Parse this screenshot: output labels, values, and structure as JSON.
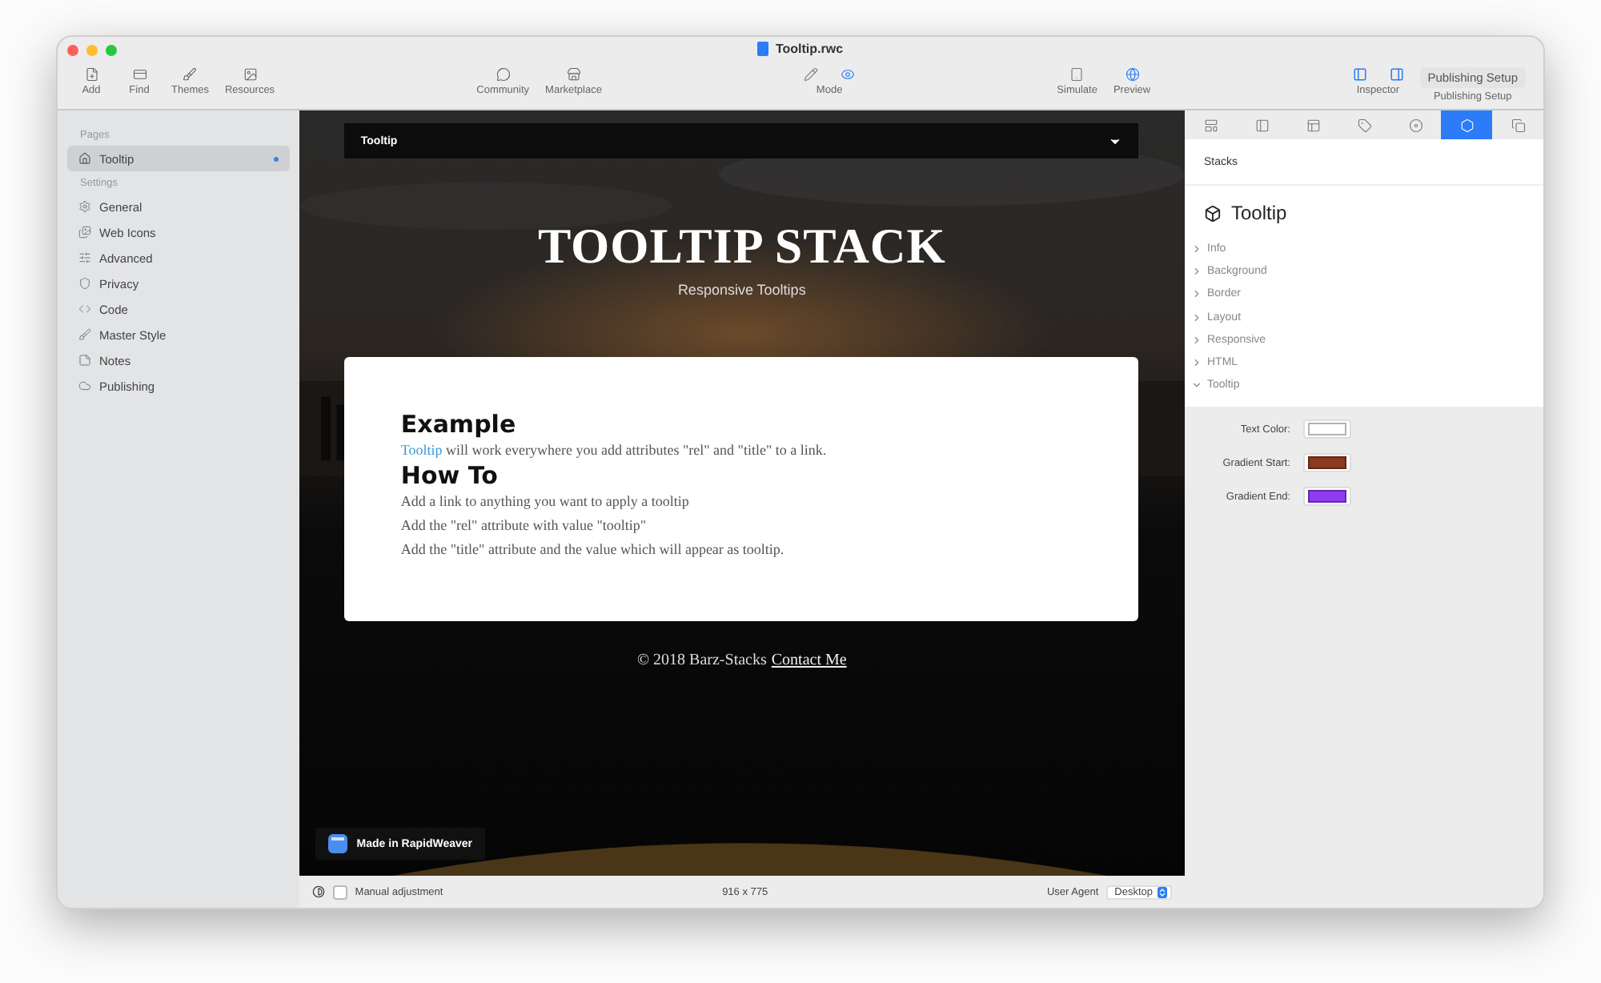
{
  "window": {
    "title": "Tooltip.rwc"
  },
  "toolbar": {
    "left": [
      {
        "label": "Add"
      },
      {
        "label": "Find"
      },
      {
        "label": "Themes"
      },
      {
        "label": "Resources"
      }
    ],
    "center": [
      {
        "label": "Community"
      },
      {
        "label": "Marketplace"
      }
    ],
    "mode": {
      "label": "Mode",
      "options": [
        {
          "selected": false
        },
        {
          "selected": true
        }
      ]
    },
    "right": [
      {
        "label": "Simulate"
      },
      {
        "label": "Preview"
      }
    ],
    "inspector": {
      "label": "Inspector"
    },
    "publishing": {
      "button": "Publishing Setup",
      "label": "Publishing Setup"
    }
  },
  "sidebar": {
    "pages_heading": "Pages",
    "pages": [
      {
        "label": "Tooltip",
        "selected": true,
        "modified": true
      }
    ],
    "settings_heading": "Settings",
    "settings": [
      {
        "label": "General"
      },
      {
        "label": "Web Icons"
      },
      {
        "label": "Advanced"
      },
      {
        "label": "Privacy"
      },
      {
        "label": "Code"
      },
      {
        "label": "Master Style"
      },
      {
        "label": "Notes"
      },
      {
        "label": "Publishing"
      }
    ]
  },
  "preview": {
    "nav": {
      "title": "Tooltip"
    },
    "title": "TOOLTIP STACK",
    "subtitle": "Responsive Tooltips",
    "card": [
      {
        "kind": "heading",
        "text": "Example"
      },
      {
        "kind": "linked",
        "link": "Tooltip",
        "text": " will work everywhere you add attributes \"rel\" and \"title\" to a link."
      },
      {
        "kind": "heading",
        "text": "How To"
      },
      {
        "kind": "line",
        "text": "Add a link to anything you want to apply a tooltip"
      },
      {
        "kind": "line",
        "text": "Add the \"rel\" attribute with value \"tooltip\""
      },
      {
        "kind": "line",
        "text": "Add the \"title\" attribute and the value which will appear as tooltip."
      }
    ],
    "footer": {
      "text": "© 2018 Barz-Stacks",
      "link": "Contact Me"
    },
    "badge": "Made in RapidWeaver"
  },
  "status_bar": {
    "manual": {
      "label": "Manual adjustment",
      "checked": false
    },
    "size": "916 x 775",
    "agent_label": "User Agent",
    "agent": "Desktop"
  },
  "inspector": {
    "tabs": [
      {
        "selected": false
      },
      {
        "selected": false
      },
      {
        "selected": false
      },
      {
        "selected": false
      },
      {
        "selected": false
      },
      {
        "selected": true
      },
      {
        "selected": false
      }
    ],
    "section": "Stacks",
    "stack_title": "Tooltip",
    "groups": [
      {
        "label": "Info",
        "expanded": false
      },
      {
        "label": "Background",
        "expanded": false
      },
      {
        "label": "Border",
        "expanded": false
      },
      {
        "label": "Layout",
        "expanded": false
      },
      {
        "label": "Responsive",
        "expanded": false
      },
      {
        "label": "HTML",
        "expanded": false
      },
      {
        "label": "Tooltip",
        "expanded": true
      }
    ],
    "properties": [
      {
        "label": "Text Color:",
        "color": "#ffffff"
      },
      {
        "label": "Gradient Start:",
        "color": "#8b3a1e"
      },
      {
        "label": "Gradient End:",
        "color": "#8f3cf0"
      }
    ]
  }
}
